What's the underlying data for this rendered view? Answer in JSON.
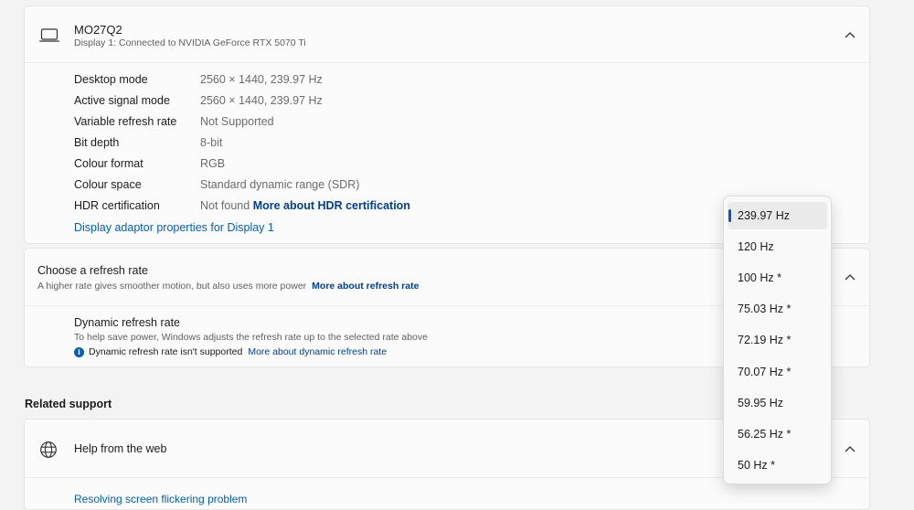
{
  "display": {
    "title": "MO27Q2",
    "subtitle": "Display 1: Connected to NVIDIA GeForce RTX 5070 Ti",
    "icon": "monitor-icon",
    "rows": [
      {
        "label": "Desktop mode",
        "value": "2560 × 1440, 239.97 Hz"
      },
      {
        "label": "Active signal mode",
        "value": "2560 × 1440, 239.97 Hz"
      },
      {
        "label": "Variable refresh rate",
        "value": "Not Supported"
      },
      {
        "label": "Bit depth",
        "value": "8-bit"
      },
      {
        "label": "Colour format",
        "value": "RGB"
      },
      {
        "label": "Colour space",
        "value": "Standard dynamic range (SDR)"
      },
      {
        "label": "HDR certification",
        "value": "Not found",
        "link": "More about HDR certification"
      }
    ],
    "adapter_link": "Display adaptor properties for Display 1"
  },
  "refresh": {
    "title": "Choose a refresh rate",
    "subtitle": "A higher rate gives smoother motion, but also uses more power",
    "subtitle_link": "More about refresh rate",
    "dynamic_title": "Dynamic refresh rate",
    "dynamic_subtitle": "To help save power, Windows adjusts the refresh rate up to the selected rate above",
    "dynamic_note": "Dynamic refresh rate isn't supported",
    "dynamic_note_link": "More about dynamic refresh rate"
  },
  "related": {
    "heading": "Related support",
    "help_title": "Help from the web",
    "help_link_partial": "Resolving screen flickering problem"
  },
  "dropdown": {
    "selected": "239.97 Hz",
    "options": [
      "239.97 Hz",
      "120 Hz",
      "100 Hz *",
      "75.03 Hz *",
      "72.19 Hz *",
      "70.07 Hz *",
      "59.95 Hz",
      "56.25 Hz *",
      "50 Hz *"
    ]
  },
  "colors": {
    "accent": "#005fb8",
    "link_dark": "#003e92",
    "background": "#f3f3f3",
    "card": "#fbfbfb"
  }
}
